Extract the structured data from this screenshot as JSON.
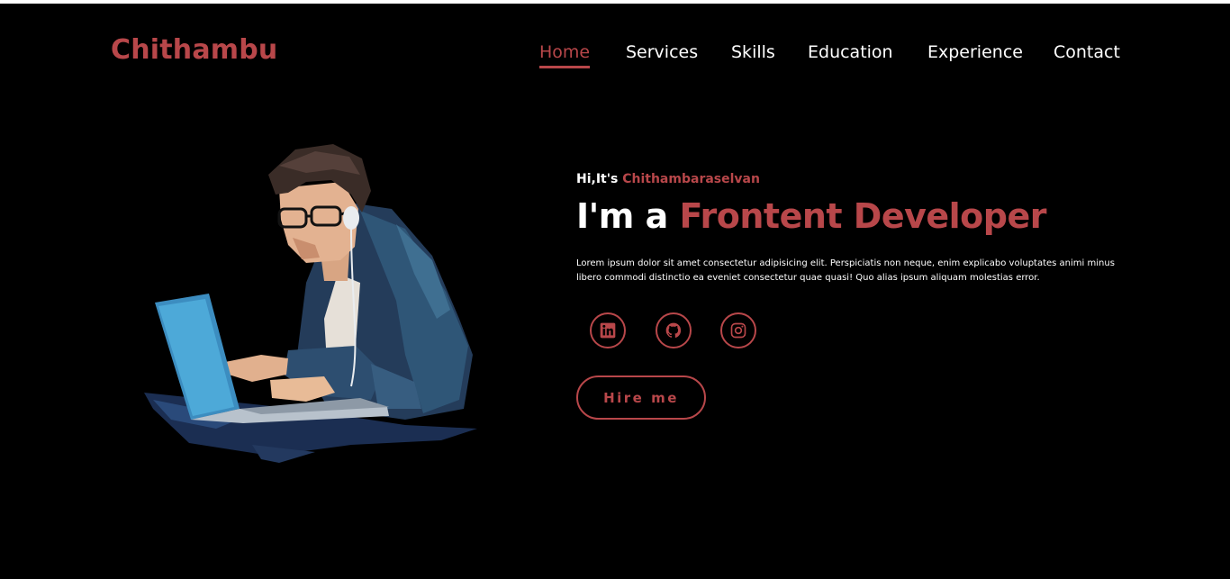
{
  "brand": {
    "logo_text": "Chithambu"
  },
  "nav": {
    "items": [
      {
        "label": "Home",
        "active": true
      },
      {
        "label": "Services",
        "active": false
      },
      {
        "label": "Skills",
        "active": false
      },
      {
        "label": "Education",
        "active": false
      },
      {
        "label": "Experience",
        "active": false
      },
      {
        "label": "Contact",
        "active": false
      }
    ]
  },
  "hero": {
    "greeting_prefix": "Hi,It's",
    "greeting_name": "Chithambaraselvan",
    "headline_prefix": "I'm a",
    "headline_role": "Frontent Developer",
    "description": "Lorem ipsum dolor sit amet consectetur adipisicing elit. Perspiciatis non neque, enim explicabo voluptates animi minus libero commodi distinctio ea eveniet consectetur quae quasi! Quo alias ipsum aliquam molestias error.",
    "socials": [
      {
        "icon": "linkedin-icon"
      },
      {
        "icon": "github-icon"
      },
      {
        "icon": "instagram-icon"
      }
    ],
    "cta_label": "Hire me",
    "illustration": "developer-with-laptop-illustration"
  },
  "colors": {
    "accent": "#b8474a",
    "background": "#000000",
    "text": "#ffffff"
  }
}
